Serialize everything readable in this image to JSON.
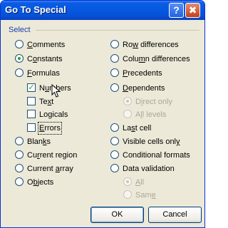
{
  "window": {
    "title": "Go To Special",
    "help_glyph": "?",
    "close_glyph": "✖"
  },
  "group": {
    "label": "Select"
  },
  "left_options": [
    {
      "text": "Comments",
      "ul": "C",
      "type": "radio",
      "state": "off"
    },
    {
      "text": "Constants",
      "ul": "o",
      "type": "radio",
      "state": "on"
    },
    {
      "text": "Formulas",
      "ul": "F",
      "type": "radio",
      "state": "off"
    },
    {
      "text": "Numbers",
      "ul": "u",
      "type": "check",
      "state": "checked"
    },
    {
      "text": "Text",
      "ul": "x",
      "type": "check",
      "state": "unchecked"
    },
    {
      "text": "Logicals",
      "ul": "g",
      "type": "check",
      "state": "unchecked"
    },
    {
      "text": "Errors",
      "ul": "E",
      "type": "check",
      "state": "unchecked"
    },
    {
      "text": "Blanks",
      "ul": "k",
      "type": "radio",
      "state": "off"
    },
    {
      "text": "Current region",
      "ul": "r",
      "type": "radio",
      "state": "off"
    },
    {
      "text": "Current array",
      "ul": "a",
      "type": "radio",
      "state": "off"
    },
    {
      "text": "Objects",
      "ul": "b",
      "type": "radio",
      "state": "off"
    }
  ],
  "right_options": [
    {
      "text": "Row differences",
      "ul": "w",
      "type": "radio",
      "state": "off",
      "enabled": true
    },
    {
      "text": "Column differences",
      "ul": "m",
      "type": "radio",
      "state": "off",
      "enabled": true
    },
    {
      "text": "Precedents",
      "ul": "P",
      "type": "radio",
      "state": "off",
      "enabled": true
    },
    {
      "text": "Dependents",
      "ul": "D",
      "type": "radio",
      "state": "off",
      "enabled": true
    },
    {
      "text": "Direct only",
      "ul": "i",
      "type": "radio",
      "state": "on",
      "enabled": false
    },
    {
      "text": "All levels",
      "ul": "l",
      "type": "radio",
      "state": "off",
      "enabled": false
    },
    {
      "text": "Last cell",
      "ul": "s",
      "type": "radio",
      "state": "off",
      "enabled": true
    },
    {
      "text": "Visible cells only",
      "ul": "y",
      "type": "radio",
      "state": "off",
      "enabled": true
    },
    {
      "text": "Conditional formats",
      "ul": "T",
      "type": "radio",
      "state": "off",
      "enabled": true
    },
    {
      "text": "Data validation",
      "ul": "V",
      "type": "radio",
      "state": "off",
      "enabled": true
    },
    {
      "text": "All",
      "ul": "A",
      "type": "radio",
      "state": "on",
      "enabled": false
    },
    {
      "text": "Same",
      "ul": "e",
      "type": "radio",
      "state": "off",
      "enabled": false
    }
  ],
  "buttons": {
    "ok": "OK",
    "cancel": "Cancel"
  },
  "colors": {
    "titlebar": "#0658df",
    "dialog_bg": "#ece9d8",
    "group_label": "#1a3fb5",
    "check_mark": "#22a41f",
    "disabled_text": "#aca899"
  }
}
